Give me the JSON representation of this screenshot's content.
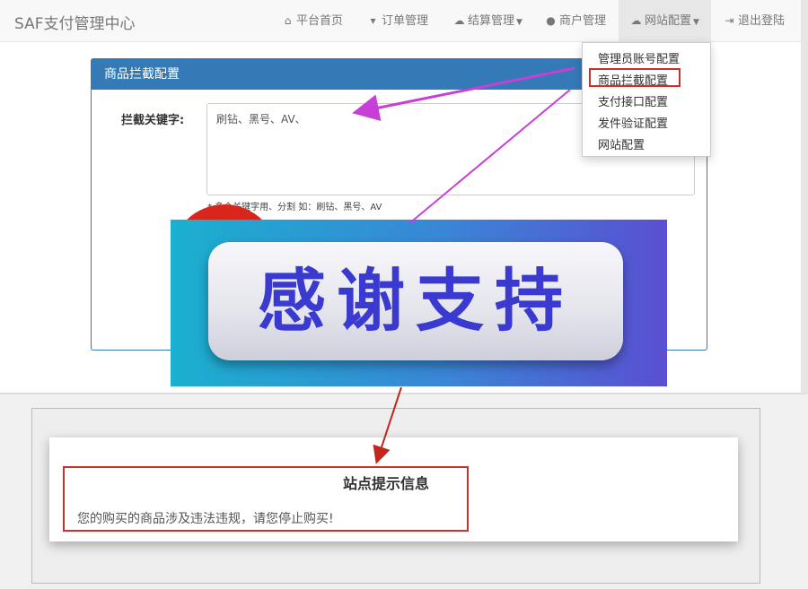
{
  "navbar": {
    "brand": "SAF支付管理中心",
    "items": [
      {
        "label": "平台首页",
        "icon": "home-icon"
      },
      {
        "label": "订单管理",
        "icon": "cart-icon"
      },
      {
        "label": "结算管理",
        "icon": "cloud-icon"
      },
      {
        "label": "商户管理",
        "icon": "user-icon"
      },
      {
        "label": "网站配置",
        "icon": "cloud-icon"
      },
      {
        "label": "退出登陆",
        "icon": "logout-icon"
      }
    ]
  },
  "dropdown": {
    "items": [
      "管理员账号配置",
      "商品拦截配置",
      "支付接口配置",
      "发件验证配置",
      "网站配置"
    ]
  },
  "panel": {
    "title": "商品拦截配置",
    "keyword_label": "拦截关键字:",
    "keyword_value": "刷钻、黑号、AV、",
    "help_text": "* 多个关键字用、分割 如：刷钻、黑号、AV"
  },
  "banner": {
    "text": "感谢支持"
  },
  "modal": {
    "title": "站点提示信息",
    "message": "您的购买的商品涉及违法违规，请您停止购买!"
  },
  "colors": {
    "accent": "#337ab7",
    "highlight": "#c9302c",
    "arrow_magenta": "#c83fd8",
    "arrow_red": "#c0281e"
  }
}
